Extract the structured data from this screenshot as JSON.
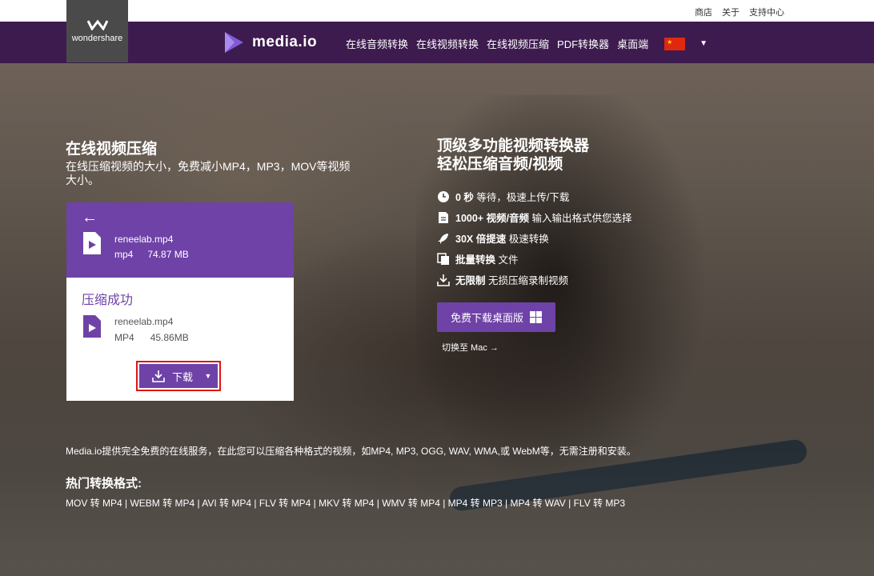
{
  "topbar": {
    "links": [
      "商店",
      "关于",
      "支持中心"
    ]
  },
  "nav": {
    "logo_text": "wondershare",
    "brand": "media.io",
    "menu": [
      "在线音频转换",
      "在线视频转换",
      "在线视频压缩",
      "PDF转换器",
      "桌面端"
    ]
  },
  "hero": {
    "title": "在线视频压缩",
    "subtitle": "在线压缩视频的大小，免费减小MP4，MP3，MOV等视频大小。"
  },
  "card": {
    "original": {
      "name": "reneelab.mp4",
      "format": "mp4",
      "size": "74.87 MB"
    },
    "status": "压缩成功",
    "compressed": {
      "name": "reneelab.mp4",
      "format": "MP4",
      "size": "45.86MB"
    },
    "download_label": "下载"
  },
  "right": {
    "title_line1": "顶级多功能视频转换器",
    "title_line2": "轻松压缩音频/视频",
    "features": [
      {
        "bold": "0 秒",
        "text": "等待，极速上传/下载",
        "icon": "clock-icon"
      },
      {
        "bold": "1000+ 视频/音频",
        "text": "输入输出格式供您选择",
        "icon": "document-icon"
      },
      {
        "bold": "30X 倍提速",
        "text": "极速转换",
        "icon": "rocket-icon"
      },
      {
        "bold": "批量转换",
        "text": "文件",
        "icon": "copy-icon"
      },
      {
        "bold": "无限制",
        "text": "无损压缩录制视频",
        "icon": "download-icon"
      }
    ],
    "cta_label": "免费下载桌面版",
    "mac_link": "切换至 Mac"
  },
  "footer": {
    "description": "Media.io提供完全免费的在线服务，在此您可以压缩各种格式的视频，如MP4, MP3, OGG, WAV, WMA,或 WebM等，无需注册和安装。",
    "popular_title": "热门转换格式:",
    "popular_list": "MOV 转 MP4 | WEBM 转 MP4 | AVI 转 MP4 | FLV 转 MP4 | MKV 转 MP4 | WMV 转 MP4 | MP4 转 MP3 | MP4 转 WAV | FLV 转 MP3"
  },
  "colors": {
    "nav_bg": "#3d1b4e",
    "accent": "#6f42a7",
    "highlight": "#e01515",
    "flag": "#de2910"
  }
}
